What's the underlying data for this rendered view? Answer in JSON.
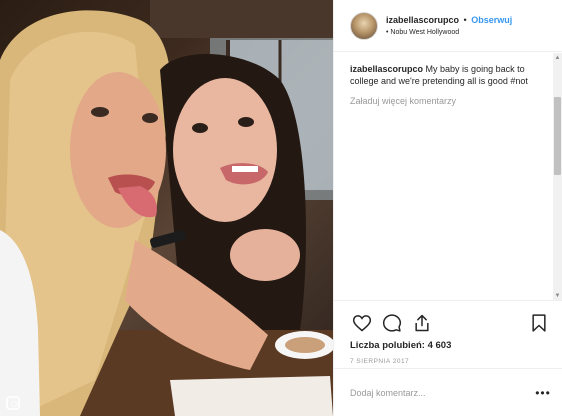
{
  "post": {
    "photo": {
      "description_icon": "gallery-corner-icon"
    },
    "header": {
      "username": "izabellascorupco",
      "separator": "•",
      "follow_label": "Obserwuj",
      "location_prefix": "•",
      "location": "Nobu West Hollywood"
    },
    "caption": {
      "username": "izabellascorupco",
      "text": "My baby is going back to college and we're pretending all is good #not"
    },
    "load_more_label": "Załaduj więcej komentarzy",
    "actions": {
      "like_icon": "heart-icon",
      "comment_icon": "comment-icon",
      "share_icon": "share-icon",
      "save_icon": "bookmark-icon"
    },
    "likes_label": "Liczba polubień: 4 603",
    "timestamp": "7 SIERPNIA 2017",
    "comment_box": {
      "placeholder": "Dodaj komentarz...",
      "more_label": "•••"
    }
  }
}
